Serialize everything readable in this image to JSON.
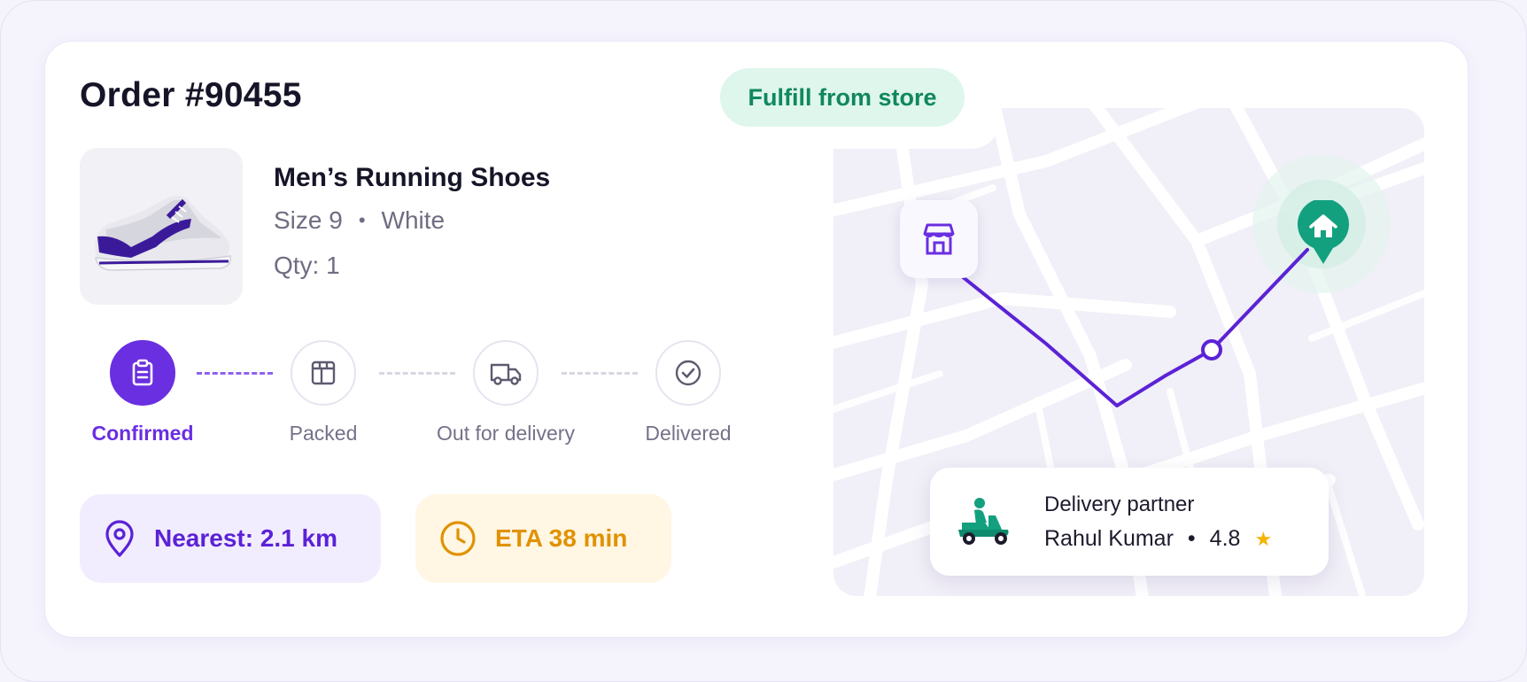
{
  "order": {
    "title": "Order #90455",
    "fulfillment_badge": "Fulfill from store"
  },
  "product": {
    "name": "Men’s Running Shoes",
    "size": "Size 9",
    "separator": "•",
    "color": "White",
    "qty": "Qty: 1"
  },
  "timeline": {
    "steps": [
      {
        "label": "Confirmed",
        "icon": "clipboard-icon",
        "state": "active"
      },
      {
        "label": "Packed",
        "icon": "box-icon",
        "state": "pending"
      },
      {
        "label": "Out for delivery",
        "icon": "truck-icon",
        "state": "pending"
      },
      {
        "label": "Delivered",
        "icon": "check-circle-icon",
        "state": "pending"
      }
    ]
  },
  "stats": {
    "nearest": "Nearest: 2.1 km",
    "eta": "ETA 38 min"
  },
  "map": {
    "store_icon": "store-icon",
    "home_icon": "home-icon"
  },
  "partner": {
    "label": "Delivery partner",
    "name": "Rahul Kumar",
    "separator": "•",
    "rating": "4.8",
    "icon": "scooter-icon"
  },
  "colors": {
    "accent": "#6a2fe0",
    "success": "#10875f",
    "warning": "#e09200",
    "route": "#5b22d6",
    "home_pin": "#13a07f"
  }
}
